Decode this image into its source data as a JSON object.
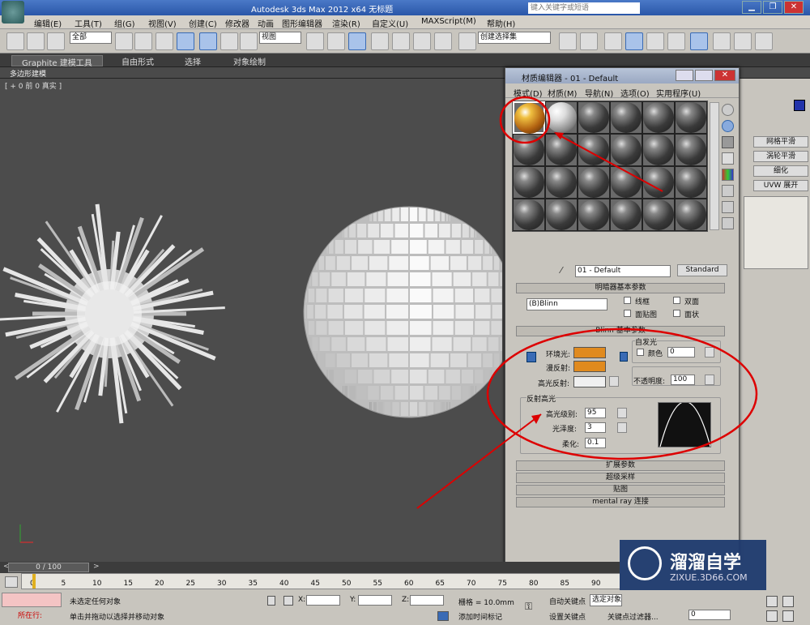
{
  "app": {
    "title": "Autodesk 3ds Max  2012 x64      无标题",
    "search_placeholder": "键入关键字或短语"
  },
  "menu": [
    "编辑(E)",
    "工具(T)",
    "组(G)",
    "视图(V)",
    "创建(C)",
    "修改器",
    "动画",
    "图形编辑器",
    "渲染(R)",
    "自定义(U)",
    "MAXScript(M)",
    "帮助(H)"
  ],
  "toolbar": {
    "filter": "全部",
    "ref_coord": "视图",
    "named_sel": "创建选择集"
  },
  "ribbon": {
    "tabs": [
      "Graphite 建模工具",
      "自由形式",
      "选择",
      "对象绘制"
    ],
    "sub": "多边形建模"
  },
  "viewport": {
    "label": "[ + 0 前 0 真实 ]"
  },
  "right_panel": {
    "buttons": [
      "网格平滑",
      "涡轮平滑",
      "细化",
      "UVW 展开"
    ]
  },
  "material_editor": {
    "title": "材质编辑器 - 01 - Default",
    "menu": [
      "模式(D)",
      "材质(M)",
      "导航(N)",
      "选项(O)",
      "实用程序(U)"
    ],
    "material_name": "01 - Default",
    "material_type": "Standard",
    "shader_rollout": "明暗器基本参数",
    "shader": "(B)Blinn",
    "shader_opts": [
      "线框",
      "双面",
      "面贴图",
      "面状"
    ],
    "blinn_rollout": "Blinn 基本参数",
    "self_illum": "自发光",
    "color_label": "颜色",
    "color_value": "0",
    "ambient": "环境光:",
    "diffuse": "漫反射:",
    "specular": "高光反射:",
    "opacity_label": "不透明度:",
    "opacity": "100",
    "spec_group": "反射高光",
    "spec_level_label": "高光级别:",
    "spec_level": "95",
    "gloss_label": "光泽度:",
    "gloss": "3",
    "soften_label": "柔化:",
    "soften": "0.1",
    "collapsed": [
      "扩展参数",
      "超级采样",
      "贴图",
      "mental ray 连接"
    ],
    "colors": {
      "ambient": "#e08a1e",
      "diffuse": "#e08a1e",
      "specular": "#f0f0f0"
    }
  },
  "timeline": {
    "frame": "0 / 100",
    "ticks": [
      "0",
      "5",
      "10",
      "15",
      "20",
      "25",
      "30",
      "35",
      "40",
      "45",
      "50",
      "55",
      "60",
      "65",
      "70",
      "75",
      "80",
      "85",
      "90"
    ]
  },
  "status": {
    "selection": "未选定任何对象",
    "hint": "单击并拖动以选择并移动对象",
    "in_use": "所在行:",
    "grid": "栅格 = 10.0mm",
    "auto_key": "自动关键点",
    "set_key": "设置关键点",
    "selected": "选定对象",
    "key_filters": "关键点过滤器...",
    "add_time_tag": "添加时间标记",
    "frame_value": "0",
    "x_label": "X:",
    "y_label": "Y:",
    "z_label": "Z:"
  },
  "watermark": {
    "name": "溜溜自学",
    "url": "ZIXUE.3D66.COM"
  }
}
